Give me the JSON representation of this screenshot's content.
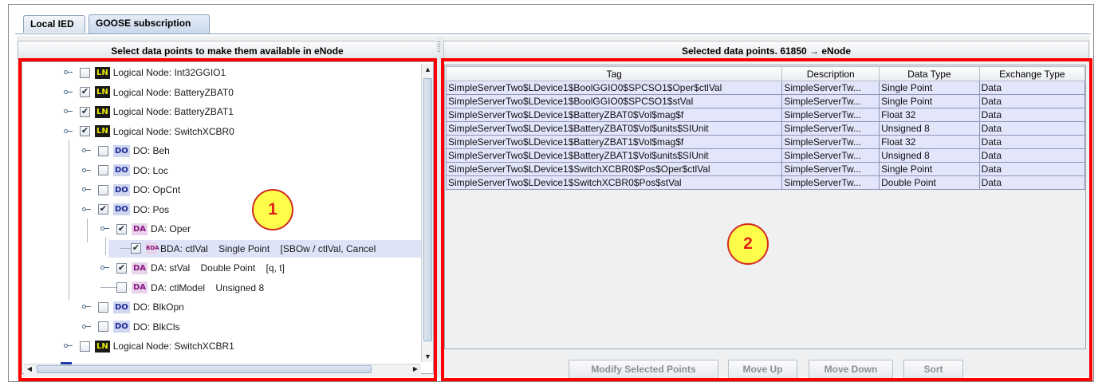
{
  "tabs": [
    {
      "label": "Local IED"
    },
    {
      "label": "GOOSE subscription"
    }
  ],
  "left_pane": {
    "header": "Select data points to make them available in eNode",
    "tree": [
      {
        "type": "LN",
        "badge": "LN",
        "label": "Logical Node: Int32GGIO1",
        "checked": false
      },
      {
        "type": "LN",
        "badge": "LN",
        "label": "Logical Node: BatteryZBAT0",
        "checked": true
      },
      {
        "type": "LN",
        "badge": "LN",
        "label": "Logical Node: BatteryZBAT1",
        "checked": true
      },
      {
        "type": "LN",
        "badge": "LN",
        "label": "Logical Node: SwitchXCBR0",
        "checked": true
      },
      {
        "type": "DO",
        "badge": "DO",
        "label": "DO: Beh",
        "checked": false
      },
      {
        "type": "DO",
        "badge": "DO",
        "label": "DO: Loc",
        "checked": false
      },
      {
        "type": "DO",
        "badge": "DO",
        "label": "DO: OpCnt",
        "checked": false
      },
      {
        "type": "DO",
        "badge": "DO",
        "label": "DO: Pos",
        "checked": true
      },
      {
        "type": "DA",
        "badge": "DA",
        "label": "DA: Oper",
        "checked": true
      },
      {
        "type": "BDA",
        "badge": "BDA",
        "label": "BDA: ctlVal    Single Point    [SBOw / ctlVal, Cancel",
        "checked": true
      },
      {
        "type": "DA",
        "badge": "DA",
        "label": "DA: stVal    Double Point    [q, t]",
        "checked": true
      },
      {
        "type": "DA",
        "badge": "DA",
        "label": "DA: ctlModel    Unsigned 8",
        "checked": false
      },
      {
        "type": "DO",
        "badge": "DO",
        "label": "DO: BlkOpn",
        "checked": false
      },
      {
        "type": "DO",
        "badge": "DO",
        "label": "DO: BlkCls",
        "checked": false
      },
      {
        "type": "LN",
        "badge": "LN",
        "label": "Logical Node: SwitchXCBR1",
        "checked": false
      }
    ],
    "checkmark": "✔"
  },
  "right_pane": {
    "header": "Selected data points. 61850 → eNode",
    "columns": [
      "Tag",
      "Description",
      "Data Type",
      "Exchange Type"
    ],
    "rows": [
      [
        "SimpleServerTwo$LDevice1$BoolGGIO0$SPCSO1$Oper$ctlVal",
        "SimpleServerTw...",
        "Single Point",
        "Data"
      ],
      [
        "SimpleServerTwo$LDevice1$BoolGGIO0$SPCSO1$stVal",
        "SimpleServerTw...",
        "Single Point",
        "Data"
      ],
      [
        "SimpleServerTwo$LDevice1$BatteryZBAT0$Vol$mag$f",
        "SimpleServerTw...",
        "Float 32",
        "Data"
      ],
      [
        "SimpleServerTwo$LDevice1$BatteryZBAT0$Vol$units$SIUnit",
        "SimpleServerTw...",
        "Unsigned 8",
        "Data"
      ],
      [
        "SimpleServerTwo$LDevice1$BatteryZBAT1$Vol$mag$f",
        "SimpleServerTw...",
        "Float 32",
        "Data"
      ],
      [
        "SimpleServerTwo$LDevice1$BatteryZBAT1$Vol$units$SIUnit",
        "SimpleServerTw...",
        "Unsigned 8",
        "Data"
      ],
      [
        "SimpleServerTwo$LDevice1$SwitchXCBR0$Pos$Oper$ctlVal",
        "SimpleServerTw...",
        "Single Point",
        "Data"
      ],
      [
        "SimpleServerTwo$LDevice1$SwitchXCBR0$Pos$stVal",
        "SimpleServerTw...",
        "Double Point",
        "Data"
      ]
    ],
    "buttons": {
      "modify": "Modify Selected Points",
      "move_up": "Move Up",
      "move_down": "Move Down",
      "sort": "Sort"
    }
  },
  "callouts": {
    "one": "1",
    "two": "2"
  },
  "colors": {
    "highlight": "#ff0000",
    "callout_fill": "#fdfd4a",
    "callout_text": "#e0221a",
    "row_fill": "#e3e5fb"
  }
}
